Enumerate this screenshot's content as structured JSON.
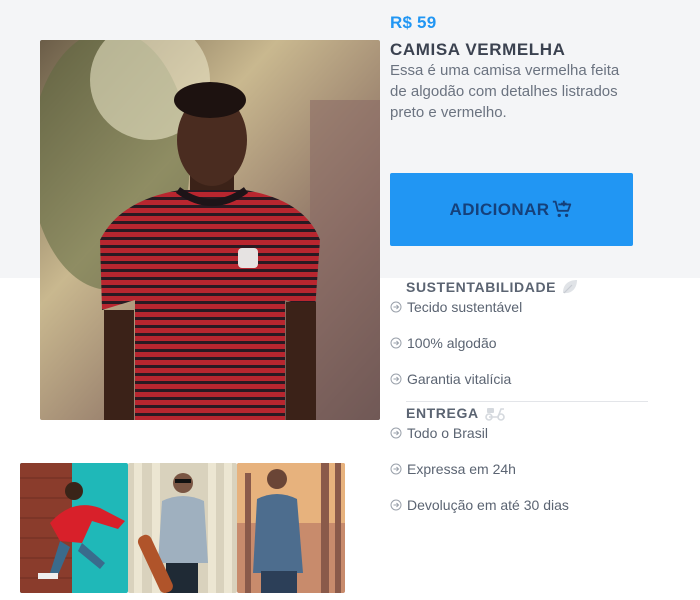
{
  "product": {
    "price": "R$ 59",
    "title": "CAMISA VERMELHA",
    "description": "Essa é uma camisa vermelha feita de algodão com detalhes listrados preto e vermelho.",
    "add_label": "ADICIONAR"
  },
  "sustainability": {
    "heading": "SUSTENTABILIDADE",
    "icon": "leaf-icon",
    "items": [
      "Tecido sustentável",
      "100% algodão",
      "Garantia vitalícia"
    ]
  },
  "delivery": {
    "heading": "ENTREGA",
    "icon": "scooter-icon",
    "items": [
      "Todo o Brasil",
      "Expressa em 24h",
      "Devolução em até 30 dias"
    ]
  },
  "colors": {
    "accent": "#2196f3",
    "button_text": "#15407a",
    "band": "#f4f5f7",
    "shirt_red": "#b8262f",
    "shirt_stripe": "#2a1a22"
  }
}
